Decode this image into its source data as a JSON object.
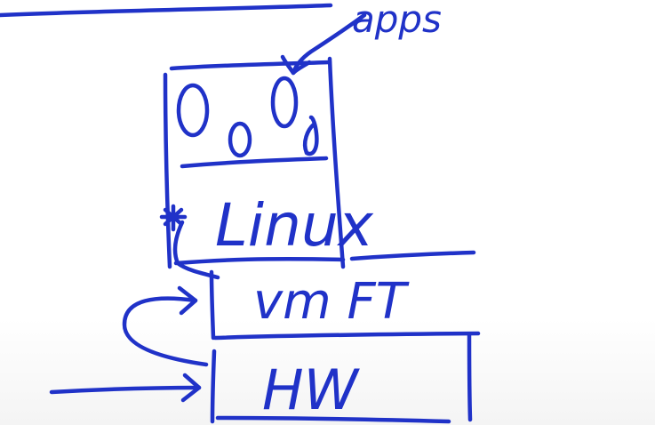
{
  "diagram": {
    "ink_color": "#2032c8",
    "labels": {
      "apps": "apps",
      "linux": "Linux",
      "vm_ft": "vm FT",
      "hw": "HW"
    }
  }
}
